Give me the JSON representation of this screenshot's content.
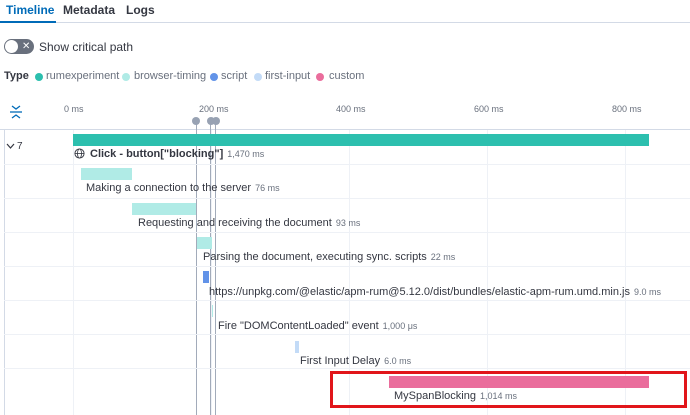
{
  "tabs": [
    "Timeline",
    "Metadata",
    "Logs"
  ],
  "toggle": {
    "label": "Show critical path",
    "checked": false
  },
  "legend": {
    "title": "Type",
    "items": [
      {
        "label": "rumexperiment",
        "color": "#2cbfae"
      },
      {
        "label": "browser-timing",
        "color": "#b0ebe6"
      },
      {
        "label": "script",
        "color": "#6293e8"
      },
      {
        "label": "first-input",
        "color": "#c3dbf7"
      },
      {
        "label": "custom",
        "color": "#ea6d9c"
      }
    ]
  },
  "axis": {
    "ticks": [
      "0 ms",
      "200 ms",
      "400 ms",
      "600 ms",
      "800 ms"
    ]
  },
  "group": {
    "count": "7"
  },
  "rows": [
    {
      "name": "Click - button[\"blocking\"]",
      "duration": "1,470 ms",
      "color": "#2cbfae"
    },
    {
      "name": "Making a connection to the server",
      "duration": "76 ms",
      "color": "#b0ebe6"
    },
    {
      "name": "Requesting and receiving the document",
      "duration": "93 ms",
      "color": "#b0ebe6"
    },
    {
      "name": "Parsing the document, executing sync. scripts",
      "duration": "22 ms",
      "color": "#b0ebe6"
    },
    {
      "name": "https://unpkg.com/@elastic/apm-rum@5.12.0/dist/bundles/elastic-apm-rum.umd.min.js",
      "duration": "9.0 ms",
      "color": "#6293e8"
    },
    {
      "name": "Fire \"DOMContentLoaded\" event",
      "duration": "1,000 μs",
      "color": "#b0ebe6"
    },
    {
      "name": "First Input Delay",
      "duration": "6.0 ms",
      "color": "#c3dbf7"
    },
    {
      "name": "MySpanBlocking",
      "duration": "1,014 ms",
      "color": "#ea6d9c"
    }
  ]
}
